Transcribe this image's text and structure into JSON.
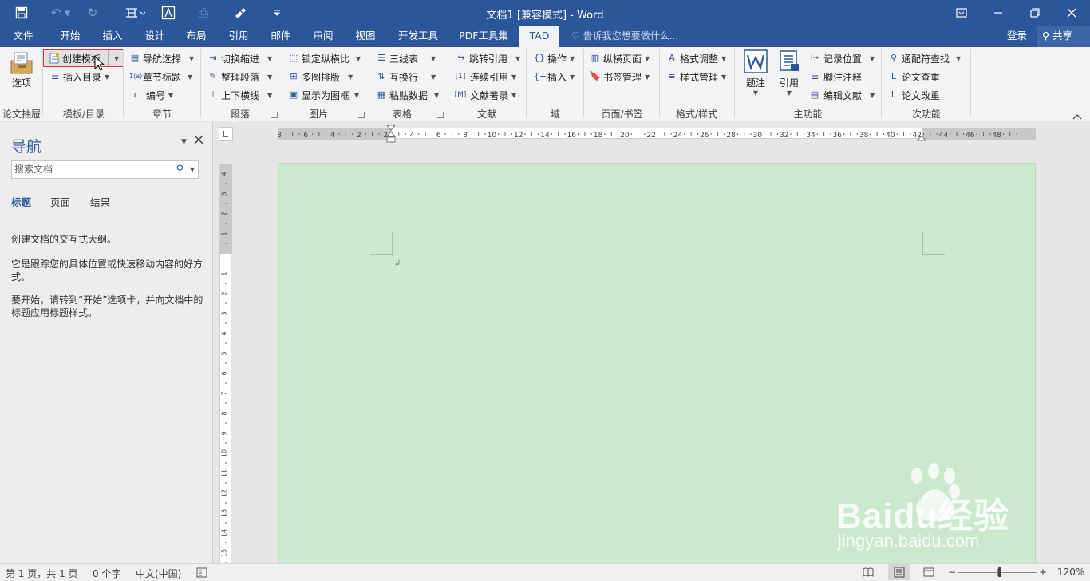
{
  "window": {
    "title": "文档1 [兼容模式] - Word",
    "controls": {
      "restore_ribbon": "restore-ribbon-icon",
      "minimize": "minimize-icon",
      "maximize": "maximize-icon",
      "close": "close-icon"
    }
  },
  "tabs": [
    "文件",
    "开始",
    "插入",
    "设计",
    "布局",
    "引用",
    "邮件",
    "审阅",
    "视图",
    "开发工具",
    "PDF工具集",
    "TAD"
  ],
  "active_tab": "TAD",
  "tell_me": "告诉我您想要做什么...",
  "login": "登录",
  "share": "共享",
  "ribbon": {
    "options": "选项",
    "create_template": "创建模板",
    "insert_toc": "插入目录",
    "nav_select": "导航选择",
    "chapter_title": "章节标题",
    "numbering": "编号",
    "toggle_indent": "切换缩进",
    "tidy_paragraph": "整理段落",
    "horizontal_line": "上下横线",
    "lock_ratio": "锁定纵横比",
    "multi_layout": "多图排版",
    "show_frame": "显示为图框",
    "three_line": "三线表",
    "swap_row": "互换行",
    "paste_data": "粘贴数据",
    "jump_ref": "跳转引用",
    "continuous_ref": "连续引用",
    "bibliography": "文献著录",
    "operate": "操作",
    "insert": "插入",
    "landscape_page": "纵横页面",
    "bookmark_mgmt": "书签管理",
    "format_adjust": "格式调整",
    "style_mgmt": "样式管理",
    "caption": "题注",
    "reference": "引用",
    "record_position": "记录位置",
    "footnote": "脚注注释",
    "edit_literature": "编辑文献",
    "wildcard_find": "通配符查找",
    "paper_check": "论文查重",
    "paper_revise": "论文改重"
  },
  "groups": [
    "论文抽屉",
    "模板/目录",
    "章节",
    "段落",
    "图片",
    "表格",
    "文献",
    "域",
    "页面/书签",
    "格式/样式",
    "主功能",
    "次功能"
  ],
  "nav": {
    "title": "导航",
    "search_placeholder": "搜索文档",
    "tabs": [
      "标题",
      "页面",
      "结果"
    ],
    "text1": "创建文档的交互式大纲。",
    "text2": "它是跟踪您的具体位置或快速移动内容的好方式。",
    "text3": "要开始，请转到“开始”选项卡，并向文档中的标题应用标题样式。"
  },
  "hruler_labels": [
    "8",
    "6",
    "4",
    "2",
    "2",
    "4",
    "6",
    "8",
    "10",
    "12",
    "14",
    "16",
    "18",
    "20",
    "22",
    "24",
    "26",
    "28",
    "30",
    "32",
    "34",
    "36",
    "38",
    "40",
    "42",
    "44",
    "46",
    "48"
  ],
  "vruler_labels": [
    "4",
    "3",
    "2",
    "1",
    "1",
    "2",
    "3",
    "4",
    "5",
    "6",
    "7",
    "8",
    "9",
    "10",
    "11",
    "12",
    "13",
    "14",
    "15"
  ],
  "watermark": {
    "brand": "Baidu经验",
    "url": "jingyan.baidu.com"
  },
  "status": {
    "page": "第 1 页，共 1 页",
    "words": "0 个字",
    "language": "中文(中国)",
    "zoom": "120%",
    "zoom_level": 1.2
  }
}
